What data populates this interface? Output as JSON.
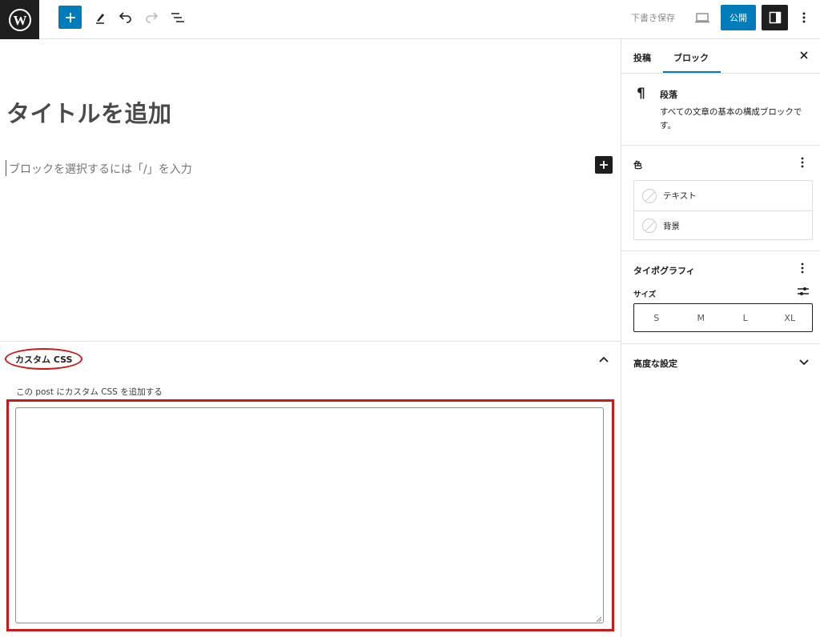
{
  "toolbar": {
    "logo_icon": "wordpress-icon",
    "inserter_icon": "plus-icon",
    "tools_icon": "pencil-icon",
    "undo_icon": "undo-icon",
    "redo_icon": "redo-icon",
    "list_view_icon": "list-view-icon",
    "save_draft_label": "下書き保存",
    "preview_icon": "laptop-icon",
    "publish_label": "公開",
    "settings_icon": "sidebar-icon",
    "options_icon": "more-vertical-icon",
    "accent_color": "#007cba"
  },
  "editor": {
    "title_placeholder": "タイトルを追加",
    "block_placeholder": "ブロックを選択するには「/」を入力",
    "add_block_icon": "plus-icon"
  },
  "custom_css": {
    "title": "カスタム CSS",
    "description": "この post にカスタム CSS を追加する",
    "value": "",
    "highlight_color": "#cc1818"
  },
  "sidebar": {
    "tabs": [
      {
        "label": "投稿",
        "active": false
      },
      {
        "label": "ブロック",
        "active": true
      }
    ],
    "block_card": {
      "icon": "paragraph-icon",
      "name": "段落",
      "description": "すべての文章の基本の構成ブロックです。"
    },
    "color_panel": {
      "title": "色",
      "items": [
        {
          "label": "テキスト"
        },
        {
          "label": "背景"
        }
      ]
    },
    "typography_panel": {
      "title": "タイポグラフィ",
      "size_label": "サイズ",
      "sizes": [
        "S",
        "M",
        "L",
        "XL"
      ]
    },
    "advanced_panel": {
      "title": "高度な設定"
    }
  }
}
